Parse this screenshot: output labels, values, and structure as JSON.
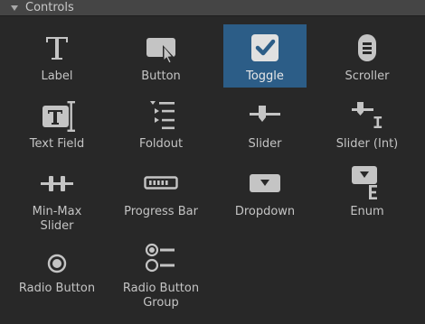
{
  "header": {
    "title": "Controls"
  },
  "controls": [
    {
      "label": "Label",
      "icon": "label-icon"
    },
    {
      "label": "Button",
      "icon": "button-icon"
    },
    {
      "label": "Toggle",
      "icon": "toggle-icon",
      "selected": true
    },
    {
      "label": "Scroller",
      "icon": "scroller-icon"
    },
    {
      "label": "Text Field",
      "icon": "text-field-icon"
    },
    {
      "label": "Foldout",
      "icon": "foldout-icon"
    },
    {
      "label": "Slider",
      "icon": "slider-icon"
    },
    {
      "label": "Slider (Int)",
      "icon": "slider-int-icon"
    },
    {
      "label": "Min-Max\nSlider",
      "icon": "min-max-slider-icon"
    },
    {
      "label": "Progress Bar",
      "icon": "progress-bar-icon"
    },
    {
      "label": "Dropdown",
      "icon": "dropdown-icon"
    },
    {
      "label": "Enum",
      "icon": "enum-icon"
    },
    {
      "label": "Radio Button",
      "icon": "radio-button-icon"
    },
    {
      "label": "Radio Button\nGroup",
      "icon": "radio-button-group-icon"
    }
  ],
  "colors": {
    "background": "#282828",
    "header": "#454545",
    "selected": "#2c5d87",
    "icon": "#c4c4c4"
  }
}
